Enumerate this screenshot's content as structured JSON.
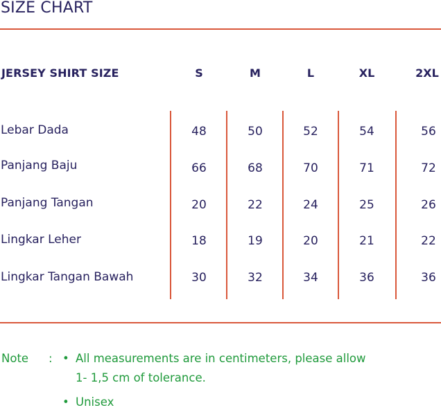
{
  "title": "SIZE CHART",
  "table": {
    "header_label": "JERSEY SHIRT SIZE",
    "sizes": [
      "S",
      "M",
      "L",
      "XL",
      "2XL"
    ],
    "rows": [
      {
        "label": "Lebar Dada",
        "values": [
          "48",
          "50",
          "52",
          "54",
          "56"
        ]
      },
      {
        "label": "Panjang Baju",
        "values": [
          "66",
          "68",
          "70",
          "71",
          "72"
        ]
      },
      {
        "label": "Panjang Tangan",
        "values": [
          "20",
          "22",
          "24",
          "25",
          "26"
        ]
      },
      {
        "label": "Lingkar Leher",
        "values": [
          "18",
          "19",
          "20",
          "21",
          "22"
        ]
      },
      {
        "label": "Lingkar Tangan Bawah",
        "values": [
          "30",
          "32",
          "34",
          "36",
          "36"
        ]
      }
    ]
  },
  "notes": {
    "label": "Note",
    "colon": ":",
    "bullet": "•",
    "items": [
      {
        "line1": "All measurements are in centimeters, please allow",
        "line2": "1- 1,5 cm of tolerance."
      },
      {
        "line1": "Unisex"
      }
    ]
  },
  "colors": {
    "text": "#27215e",
    "rule": "#d9573a",
    "note": "#1f9a3b"
  }
}
